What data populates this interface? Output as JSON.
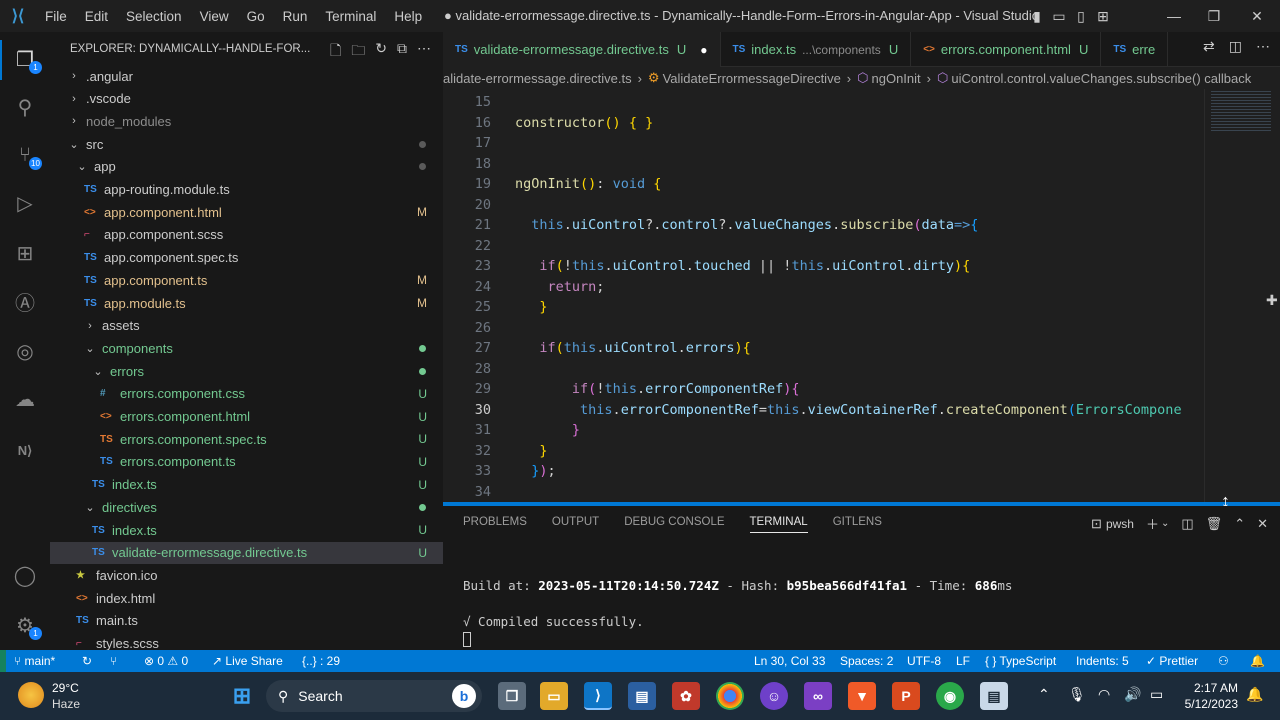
{
  "titlebar": {
    "menu": [
      "File",
      "Edit",
      "Selection",
      "View",
      "Go",
      "Run",
      "Terminal",
      "Help"
    ],
    "title": "● validate-errormessage.directive.ts - Dynamically--Handle-Form--Errors-in-Angular-App - Visual Studio C..."
  },
  "activity": {
    "explorer_badge": "1",
    "scm_badge": "10",
    "accounts_badge": "1"
  },
  "sidebar": {
    "header": "EXPLORER: DYNAMICALLY--HANDLE-FOR...",
    "items": [
      {
        "label": ".angular",
        "kind": "folder",
        "expanded": false,
        "depth": 0,
        "color": "#cccccc"
      },
      {
        "label": ".vscode",
        "kind": "folder",
        "expanded": false,
        "depth": 0,
        "color": "#cccccc"
      },
      {
        "label": "node_modules",
        "kind": "folder",
        "expanded": false,
        "depth": 0,
        "color": "#8c8c8c"
      },
      {
        "label": "src",
        "kind": "folder",
        "expanded": true,
        "depth": 0,
        "color": "#cccccc",
        "dot": "#5a5a5a"
      },
      {
        "label": "app",
        "kind": "folder",
        "expanded": true,
        "depth": 1,
        "color": "#cccccc",
        "dot": "#5a5a5a"
      },
      {
        "label": "app-routing.module.ts",
        "kind": "ts",
        "depth": 2,
        "color": "#cccccc"
      },
      {
        "label": "app.component.html",
        "kind": "html",
        "depth": 2,
        "color": "#e2c08d",
        "status": "M"
      },
      {
        "label": "app.component.scss",
        "kind": "scss",
        "depth": 2,
        "color": "#cccccc"
      },
      {
        "label": "app.component.spec.ts",
        "kind": "ts",
        "depth": 2,
        "color": "#cccccc"
      },
      {
        "label": "app.component.ts",
        "kind": "ts",
        "depth": 2,
        "color": "#e2c08d",
        "status": "M"
      },
      {
        "label": "app.module.ts",
        "kind": "ts",
        "depth": 2,
        "color": "#e2c08d",
        "status": "M"
      },
      {
        "label": "assets",
        "kind": "folder",
        "expanded": false,
        "depth": 2,
        "color": "#cccccc"
      },
      {
        "label": "components",
        "kind": "folder",
        "expanded": true,
        "depth": 2,
        "color": "#73c991",
        "dot": "#73c991"
      },
      {
        "label": "errors",
        "kind": "folder",
        "expanded": true,
        "depth": 3,
        "color": "#73c991",
        "dot": "#73c991"
      },
      {
        "label": "errors.component.css",
        "kind": "css",
        "depth": 4,
        "color": "#73c991",
        "status": "U"
      },
      {
        "label": "errors.component.html",
        "kind": "html",
        "depth": 4,
        "color": "#73c991",
        "status": "U"
      },
      {
        "label": "errors.component.spec.ts",
        "kind": "spec",
        "depth": 4,
        "color": "#73c991",
        "status": "U"
      },
      {
        "label": "errors.component.ts",
        "kind": "ts",
        "depth": 4,
        "color": "#73c991",
        "status": "U"
      },
      {
        "label": "index.ts",
        "kind": "ts",
        "depth": 3,
        "color": "#73c991",
        "status": "U"
      },
      {
        "label": "directives",
        "kind": "folder",
        "expanded": true,
        "depth": 2,
        "color": "#73c991",
        "dot": "#73c991"
      },
      {
        "label": "index.ts",
        "kind": "ts",
        "depth": 3,
        "color": "#73c991",
        "status": "U"
      },
      {
        "label": "validate-errormessage.directive.ts",
        "kind": "ts",
        "depth": 3,
        "color": "#73c991",
        "status": "U",
        "selected": true
      },
      {
        "label": "favicon.ico",
        "kind": "ico",
        "depth": 1,
        "color": "#cccccc"
      },
      {
        "label": "index.html",
        "kind": "html",
        "depth": 1,
        "color": "#cccccc"
      },
      {
        "label": "main.ts",
        "kind": "ts",
        "depth": 1,
        "color": "#cccccc"
      },
      {
        "label": "styles.scss",
        "kind": "scss",
        "depth": 1,
        "color": "#cccccc"
      }
    ]
  },
  "tabs": [
    {
      "icon": "TS",
      "label": "validate-errormessage.directive.ts",
      "status": "U",
      "dirty": true,
      "active": true,
      "color": "#73c991"
    },
    {
      "icon": "TS",
      "label": "index.ts",
      "desc": "...\\components",
      "status": "U",
      "active": false,
      "color": "#73c991"
    },
    {
      "icon": "<>",
      "label": "errors.component.html",
      "status": "U",
      "active": false,
      "color": "#73c991"
    },
    {
      "icon": "TS",
      "label": "erre",
      "active": false,
      "color": "#73c991"
    }
  ],
  "breadcrumb": [
    "alidate-errormessage.directive.ts",
    "ValidateErrormessageDirective",
    "ngOnInit",
    "uiControl.control.valueChanges.subscribe() callback"
  ],
  "code": {
    "current_line": 30,
    "lines": [
      {
        "n": 15,
        "tokens": []
      },
      {
        "n": 16,
        "tokens": [
          [
            "fn",
            "constructor"
          ],
          [
            "br1",
            "()"
          ],
          [
            "pl",
            " "
          ],
          [
            "br1",
            "{"
          ],
          [
            "pl",
            " "
          ],
          [
            "br1",
            "}"
          ]
        ]
      },
      {
        "n": 17,
        "tokens": []
      },
      {
        "n": 18,
        "tokens": []
      },
      {
        "n": 19,
        "tokens": [
          [
            "fn",
            "ngOnInit"
          ],
          [
            "br1",
            "()"
          ],
          [
            "pl",
            ": "
          ],
          [
            "kw",
            "void"
          ],
          [
            "pl",
            " "
          ],
          [
            "br1",
            "{"
          ]
        ]
      },
      {
        "n": 20,
        "tokens": []
      },
      {
        "n": 21,
        "tokens": [
          [
            "pl",
            "  "
          ],
          [
            "kw",
            "this"
          ],
          [
            "pl",
            "."
          ],
          [
            "pr",
            "uiControl"
          ],
          [
            "pl",
            "?."
          ],
          [
            "pr",
            "control"
          ],
          [
            "pl",
            "?."
          ],
          [
            "pr",
            "valueChanges"
          ],
          [
            "pl",
            "."
          ],
          [
            "fn",
            "subscribe"
          ],
          [
            "br2",
            "("
          ],
          [
            "pr",
            "data"
          ],
          [
            "kw",
            "=>"
          ],
          [
            "br3",
            "{"
          ]
        ]
      },
      {
        "n": 22,
        "tokens": []
      },
      {
        "n": 23,
        "tokens": [
          [
            "pl",
            "   "
          ],
          [
            "ctl",
            "if"
          ],
          [
            "br1",
            "("
          ],
          [
            "pl",
            "!"
          ],
          [
            "kw",
            "this"
          ],
          [
            "pl",
            "."
          ],
          [
            "pr",
            "uiControl"
          ],
          [
            "pl",
            "."
          ],
          [
            "pr",
            "touched"
          ],
          [
            "pl",
            " || !"
          ],
          [
            "kw",
            "this"
          ],
          [
            "pl",
            "."
          ],
          [
            "pr",
            "uiControl"
          ],
          [
            "pl",
            "."
          ],
          [
            "pr",
            "dirty"
          ],
          [
            "br1",
            ")"
          ],
          [
            "br1",
            "{"
          ]
        ]
      },
      {
        "n": 24,
        "tokens": [
          [
            "pl",
            "    "
          ],
          [
            "ctl",
            "return"
          ],
          [
            "pl",
            ";"
          ]
        ]
      },
      {
        "n": 25,
        "tokens": [
          [
            "pl",
            "   "
          ],
          [
            "br1",
            "}"
          ]
        ]
      },
      {
        "n": 26,
        "tokens": []
      },
      {
        "n": 27,
        "tokens": [
          [
            "pl",
            "   "
          ],
          [
            "ctl",
            "if"
          ],
          [
            "br1",
            "("
          ],
          [
            "kw",
            "this"
          ],
          [
            "pl",
            "."
          ],
          [
            "pr",
            "uiControl"
          ],
          [
            "pl",
            "."
          ],
          [
            "pr",
            "errors"
          ],
          [
            "br1",
            ")"
          ],
          [
            "br1",
            "{"
          ]
        ]
      },
      {
        "n": 28,
        "tokens": []
      },
      {
        "n": 29,
        "tokens": [
          [
            "pl",
            "       "
          ],
          [
            "ctl",
            "if"
          ],
          [
            "br2",
            "("
          ],
          [
            "pl",
            "!"
          ],
          [
            "kw",
            "this"
          ],
          [
            "pl",
            "."
          ],
          [
            "pr",
            "errorComponentRef"
          ],
          [
            "br2",
            ")"
          ],
          [
            "br2",
            "{"
          ]
        ]
      },
      {
        "n": 30,
        "tokens": [
          [
            "pl",
            "        "
          ],
          [
            "kw",
            "this"
          ],
          [
            "pl",
            "."
          ],
          [
            "pr",
            "errorComponentRef"
          ],
          [
            "pl",
            "="
          ],
          [
            "kw",
            "this"
          ],
          [
            "pl",
            "."
          ],
          [
            "pr",
            "viewContainerRef"
          ],
          [
            "pl",
            "."
          ],
          [
            "fn",
            "createComponent"
          ],
          [
            "br3",
            "("
          ],
          [
            "tp",
            "ErrorsCompone"
          ]
        ]
      },
      {
        "n": 31,
        "tokens": [
          [
            "pl",
            "       "
          ],
          [
            "br2",
            "}"
          ]
        ]
      },
      {
        "n": 32,
        "tokens": [
          [
            "pl",
            "   "
          ],
          [
            "br1",
            "}"
          ]
        ]
      },
      {
        "n": 33,
        "tokens": [
          [
            "pl",
            "  "
          ],
          [
            "br3",
            "}"
          ],
          [
            "br2",
            ")"
          ],
          [
            "pl",
            ";"
          ]
        ]
      },
      {
        "n": 34,
        "tokens": []
      }
    ]
  },
  "panel": {
    "tabs": [
      "PROBLEMS",
      "OUTPUT",
      "DEBUG CONSOLE",
      "TERMINAL",
      "GITLENS"
    ],
    "active_tab": "TERMINAL",
    "shell": "pwsh",
    "build_prefix": "Build at: ",
    "build_time": "2023-05-11T20:14:50.724Z",
    "hash_label": " - Hash: ",
    "hash": "b95bea566df41fa1",
    "time_label": " - Time: ",
    "time_value": "686",
    "time_unit": "ms",
    "compiled": "√ Compiled successfully."
  },
  "statusbar": {
    "branch": "main*",
    "problems": "⊗ 0 ⚠ 0",
    "liveshare": "Live Share",
    "symbol": "{..} : 29",
    "position": "Ln 30, Col 33",
    "spaces": "Spaces: 2",
    "encoding": "UTF-8",
    "eol": "LF",
    "language": "TypeScript",
    "indents": "Indents: 5",
    "prettier": "Prettier"
  },
  "taskbar": {
    "weather_temp": "29°C",
    "weather_text": "Haze",
    "search_label": "Search",
    "time": "2:17 AM",
    "date": "5/12/2023"
  }
}
